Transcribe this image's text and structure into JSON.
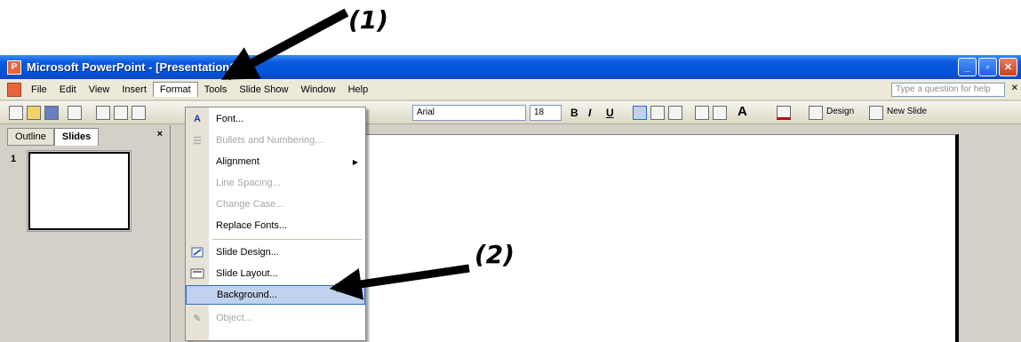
{
  "annotations": {
    "label_1": "(1)",
    "label_2": "(2)"
  },
  "window": {
    "title": "Microsoft PowerPoint - [Presentation1]",
    "controls": {
      "minimize": "_",
      "maximize": "▫",
      "close": "✕"
    }
  },
  "menubar": {
    "items": [
      "File",
      "Edit",
      "View",
      "Insert",
      "Format",
      "Tools",
      "Slide Show",
      "Window",
      "Help"
    ],
    "active": "Format",
    "help_placeholder": "Type a question for help"
  },
  "toolbar": {
    "font_name": "Arial",
    "font_size": "18",
    "bold": "B",
    "italic": "I",
    "underline": "U",
    "grow_font": "A",
    "design_label": "Design",
    "new_slide_label": "New Slide"
  },
  "left_panel": {
    "tabs": [
      "Outline",
      "Slides"
    ],
    "selected_tab": "Slides",
    "close": "×",
    "slide_number": "1"
  },
  "format_menu": {
    "items": [
      {
        "label": "Font...",
        "icon": "A",
        "enabled": true
      },
      {
        "label": "Bullets and Numbering...",
        "icon": "",
        "enabled": false
      },
      {
        "label": "Alignment",
        "icon": "",
        "enabled": true,
        "submenu": true
      },
      {
        "label": "Line Spacing...",
        "icon": "",
        "enabled": false
      },
      {
        "label": "Change Case...",
        "icon": "",
        "enabled": false
      },
      {
        "label": "Replace Fonts...",
        "icon": "",
        "enabled": true
      },
      {
        "label": "Slide Design...",
        "icon": "design-icon",
        "enabled": true
      },
      {
        "label": "Slide Layout...",
        "icon": "layout-icon",
        "enabled": true
      },
      {
        "label": "Background...",
        "icon": "",
        "enabled": true,
        "highlighted": true
      },
      {
        "label": "Object...",
        "icon": "object-icon",
        "enabled": false
      }
    ]
  }
}
